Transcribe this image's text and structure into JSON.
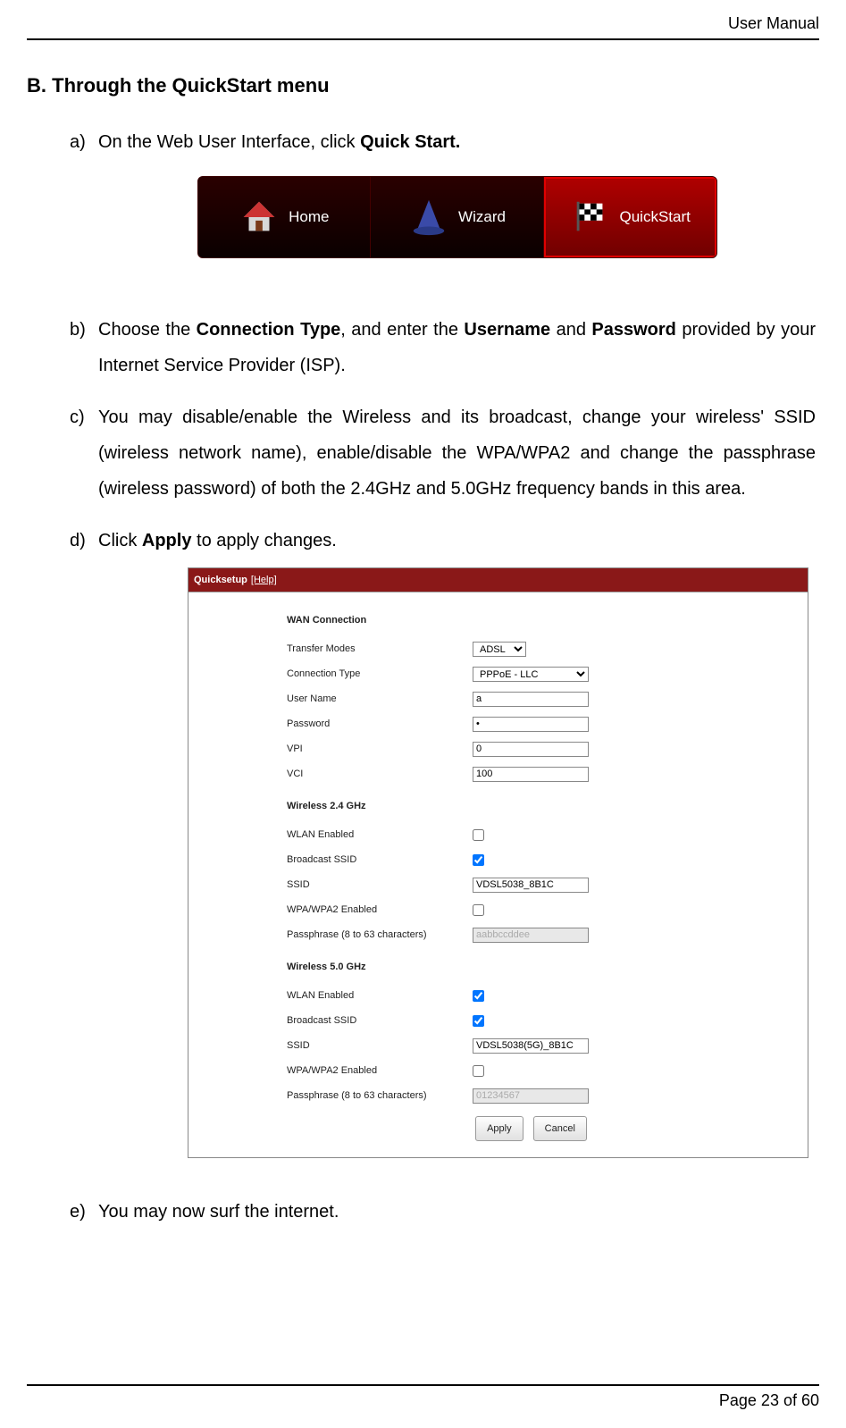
{
  "header": {
    "title": "User Manual"
  },
  "section": {
    "letter": "B.",
    "title": "Through the QuickStart menu"
  },
  "steps": {
    "a": {
      "marker": "a)",
      "pre": "On the Web User Interface, click ",
      "bold": "Quick Start."
    },
    "b": {
      "marker": "b)",
      "t1": "Choose the ",
      "b1": "Connection Type",
      "t2": ", and enter the ",
      "b2": "Username",
      "t3": " and ",
      "b3": "Password",
      "t4": " provided by your Internet Service Provider (ISP)."
    },
    "c": {
      "marker": "c)",
      "text": "You may disable/enable the Wireless and its broadcast, change your wireless' SSID (wireless network name), enable/disable the WPA/WPA2 and change the passphrase (wireless password) of both the 2.4GHz and 5.0GHz frequency bands in this area."
    },
    "d": {
      "marker": "d)",
      "t1": "Click ",
      "b1": "Apply",
      "t2": " to apply changes."
    },
    "e": {
      "marker": "e)",
      "text": "You may now surf the internet."
    }
  },
  "nav": {
    "home": "Home",
    "wizard": "Wizard",
    "quickstart": "QuickStart"
  },
  "form": {
    "header_title": "Quicksetup",
    "header_help": "[Help]",
    "wan_heading": "WAN Connection",
    "transfer_modes_label": "Transfer Modes",
    "transfer_modes_value": "ADSL",
    "connection_type_label": "Connection Type",
    "connection_type_value": "PPPoE - LLC",
    "username_label": "User Name",
    "username_value": "a",
    "password_label": "Password",
    "password_value": "•",
    "vpi_label": "VPI",
    "vpi_value": "0",
    "vci_label": "VCI",
    "vci_value": "100",
    "w24_heading": "Wireless 2.4 GHz",
    "wlan_enabled_label": "WLAN Enabled",
    "broadcast_ssid_label": "Broadcast SSID",
    "ssid_label": "SSID",
    "ssid24_value": "VDSL5038_8B1C",
    "wpa_label": "WPA/WPA2 Enabled",
    "pass_label": "Passphrase (8 to 63 characters)",
    "pass24_value": "aabbccddee",
    "w50_heading": "Wireless 5.0 GHz",
    "ssid50_value": "VDSL5038(5G)_8B1C",
    "pass50_value": "01234567",
    "apply": "Apply",
    "cancel": "Cancel"
  },
  "footer": {
    "page": "Page 23",
    "of": " of 60"
  }
}
